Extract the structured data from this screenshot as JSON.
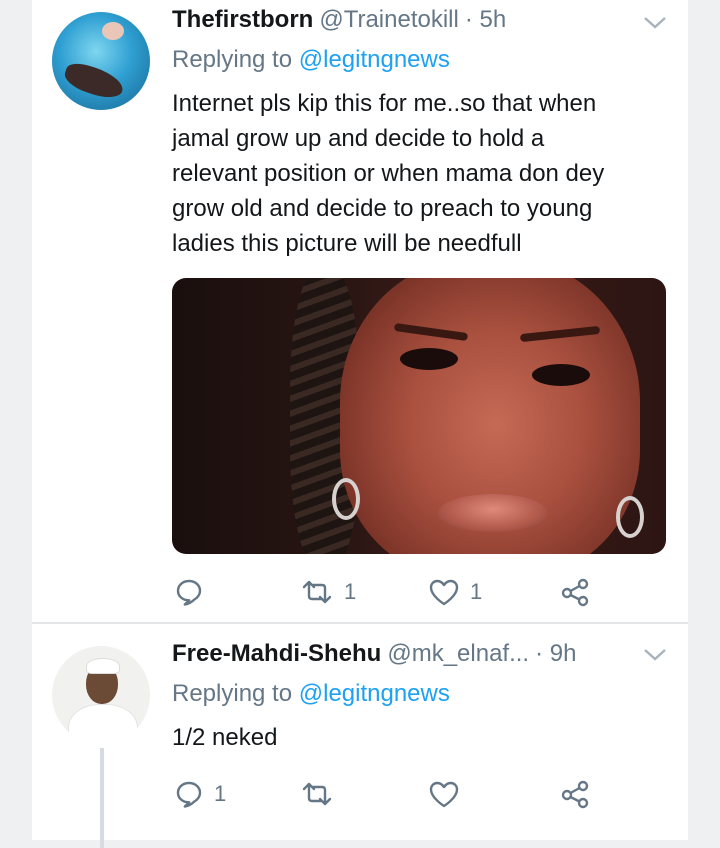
{
  "tweets": [
    {
      "name": "Thefirstborn",
      "handle": "@Trainetokill",
      "time": "· 5h",
      "replying_prefix": "Replying to",
      "replying_to": "@legitngnews",
      "text_lines": [
        "Internet pls kip this for me..so that when",
        "jamal grow up and  decide to hold a",
        "relevant position or when mama don dey",
        "grow old and decide to preach to young",
        "ladies this picture will be needfull"
      ],
      "has_media": true,
      "reply_count": "",
      "retweet_count": "1",
      "like_count": "1"
    },
    {
      "name": "Free-Mahdi-Shehu",
      "handle": "@mk_elnaf...",
      "time": "· 9h",
      "replying_prefix": "Replying to",
      "replying_to": "@legitngnews",
      "text_lines": [
        "1/2 neked"
      ],
      "has_media": false,
      "reply_count": "1",
      "retweet_count": "",
      "like_count": ""
    }
  ],
  "icons": {
    "reply": "reply-icon",
    "retweet": "retweet-icon",
    "like": "heart-icon",
    "share": "share-icon",
    "caret": "chevron-down-icon"
  },
  "colors": {
    "primary_text": "#14171a",
    "secondary_text": "#657786",
    "mention": "#1da1f2",
    "divider": "#e3e6e9"
  }
}
